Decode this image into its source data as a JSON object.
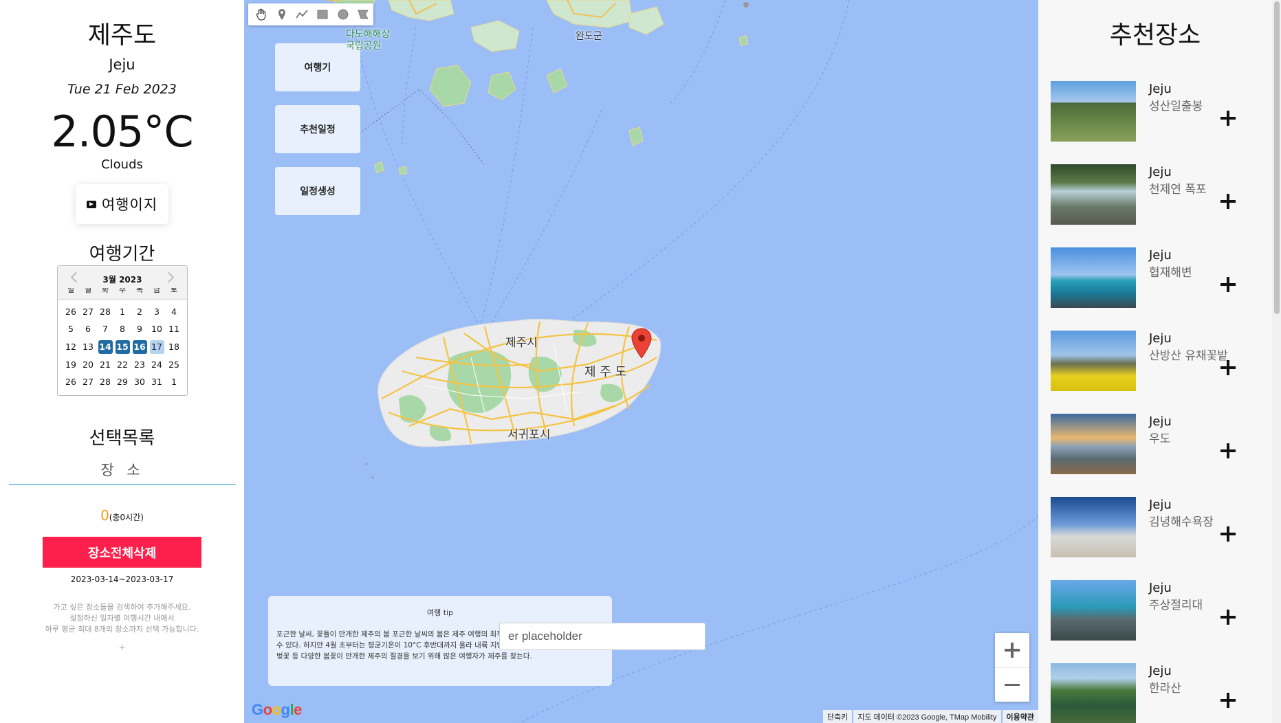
{
  "weather": {
    "city_ko": "제주도",
    "city_en": "Jeju",
    "date": "Tue 21 Feb 2023",
    "temperature": "2.05°C",
    "description": "Clouds"
  },
  "logo": {
    "text": "여행이지"
  },
  "period": {
    "title": "여행기간",
    "calendar": {
      "month_label": "3월 2023",
      "weekdays": [
        "일",
        "월",
        "화",
        "수",
        "목",
        "금",
        "토"
      ],
      "weeks": [
        [
          "26",
          "27",
          "28",
          "1",
          "2",
          "3",
          "4"
        ],
        [
          "5",
          "6",
          "7",
          "8",
          "9",
          "10",
          "11"
        ],
        [
          "12",
          "13",
          "14",
          "15",
          "16",
          "17",
          "18"
        ],
        [
          "19",
          "20",
          "21",
          "22",
          "23",
          "24",
          "25"
        ],
        [
          "26",
          "27",
          "28",
          "29",
          "30",
          "31",
          "1"
        ]
      ],
      "selected_days": [
        "14",
        "15",
        "16"
      ],
      "highlighted_day": "17",
      "selected_color": "#216ba5"
    }
  },
  "selection": {
    "title": "선택목록",
    "tab_label": "장 소",
    "count": "0",
    "total_time": "(총0시간)",
    "delete_all_label": "장소전체삭제",
    "date_range": "2023-03-14~2023-03-17",
    "help_lines": [
      "가고 싶은 장소들을 검색하여 추가해주세요.",
      "설정하신 일자별 여행시간 내에서",
      "하루 평균 최대 8개의 장소까지 선택 가능합니다."
    ],
    "plus_hint": "+",
    "accent_color": "#ff1f4c"
  },
  "map": {
    "buttons": [
      "여행기",
      "추천일정",
      "일정생성"
    ],
    "labels": {
      "park": "다도해해상\n국립공원",
      "wando": "완도군",
      "jeju_city": "제주시",
      "jeju_island": "제 주 도",
      "seogwipo": "서귀포시"
    },
    "tip": {
      "title": "여행 tip",
      "body": "포근한 날씨, 꽃들이 만개한 제주의 봄 포근한 날씨의 봄은 제주 여행의 최적기. 3월까지는 꽃샘추위로 추울 수 있다. 하지만 4월 초부터는 평균기온이 10°C 후반대까지 올라 내륙 지방보다 일찍 봄꽃이 핀다. 유채꽃, 벚꽃 등 다양한 봄꽃이 만개한 제주의 절경을 보기 위해 많은 여행자가 제주를 찾는다."
    },
    "search_placeholder": "er placeholder",
    "google_logo": "Google",
    "attribution": [
      "단축키",
      "지도 데이터 ©2023 Google, TMap Mobility",
      "이용약관"
    ],
    "water_color": "#9bbef7"
  },
  "recommend": {
    "title": "추천장소",
    "items": [
      {
        "city": "Jeju",
        "name": "성산일출봉"
      },
      {
        "city": "Jeju",
        "name": "천제연 폭포"
      },
      {
        "city": "Jeju",
        "name": "협재해변"
      },
      {
        "city": "Jeju",
        "name": "산방산 유채꽃밭"
      },
      {
        "city": "Jeju",
        "name": "우도"
      },
      {
        "city": "Jeju",
        "name": "김녕해수욕장"
      },
      {
        "city": "Jeju",
        "name": "주상절리대"
      },
      {
        "city": "Jeju",
        "name": "한라산"
      }
    ]
  }
}
